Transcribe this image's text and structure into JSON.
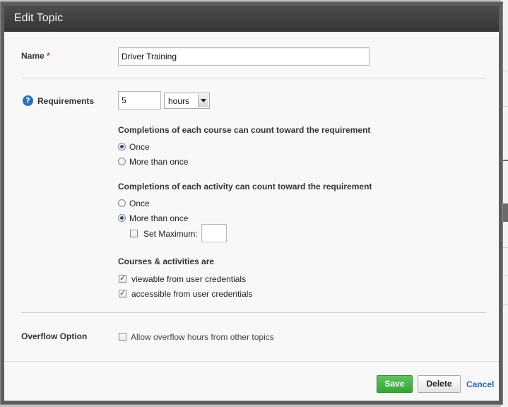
{
  "dialog": {
    "title": "Edit Topic"
  },
  "name_field": {
    "label": "Name",
    "required_marker": "*",
    "value": "Driver Training"
  },
  "requirements": {
    "label": "Requirements",
    "help_icon": "question-icon",
    "amount": "5",
    "unit_selected": "hours"
  },
  "course_completions": {
    "title": "Completions of each course can count toward the requirement",
    "options": [
      {
        "label": "Once",
        "selected": true
      },
      {
        "label": "More than once",
        "selected": false
      }
    ]
  },
  "activity_completions": {
    "title": "Completions of each activity can count toward the requirement",
    "options": [
      {
        "label": "Once",
        "selected": false
      },
      {
        "label": "More than once",
        "selected": true
      }
    ],
    "set_maximum_label": "Set Maximum:",
    "set_maximum_checked": false,
    "set_maximum_value": ""
  },
  "courses_activities": {
    "title": "Courses & activities are",
    "options": [
      {
        "label": "viewable from user credentials",
        "checked": true
      },
      {
        "label": "accessible from user credentials",
        "checked": true
      }
    ]
  },
  "overflow": {
    "label": "Overflow Option",
    "checkbox_label": "Allow overflow hours from other topics",
    "checked": false
  },
  "footer": {
    "save_label": "Save",
    "delete_label": "Delete",
    "cancel_label": "Cancel"
  },
  "colors": {
    "header": "#3f3f3f",
    "save": "#4cb24c",
    "link": "#2a66b3",
    "required": "#c0392b"
  }
}
